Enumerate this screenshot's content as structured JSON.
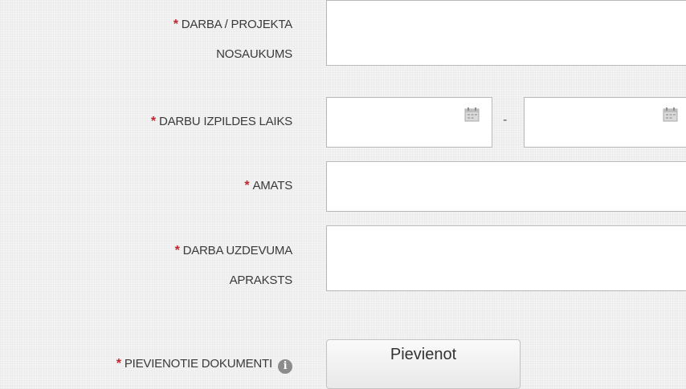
{
  "form": {
    "required_marker": "*",
    "project_name": {
      "label_line1": "DARBA / PROJEKTA",
      "label_line2": "NOSAUKUMS",
      "value": ""
    },
    "work_period": {
      "label": "DARBU IZPILDES LAIKS",
      "separator": "-",
      "from_value": "",
      "to_value": "",
      "icon": "calendar-icon"
    },
    "position": {
      "label": "AMATS",
      "value": ""
    },
    "task_description": {
      "label_line1": "DARBA UZDEVUMA",
      "label_line2": "APRAKSTS",
      "value": ""
    },
    "attached_documents": {
      "label": "PIEVIENOTIE DOKUMENTI",
      "info_icon": "info-icon",
      "add_button_label": "Pievienot"
    }
  },
  "colors": {
    "required": "#c0272d",
    "label_text": "#3a3a3a",
    "field_border": "#b9b9b9",
    "background": "#f3f3f3"
  }
}
